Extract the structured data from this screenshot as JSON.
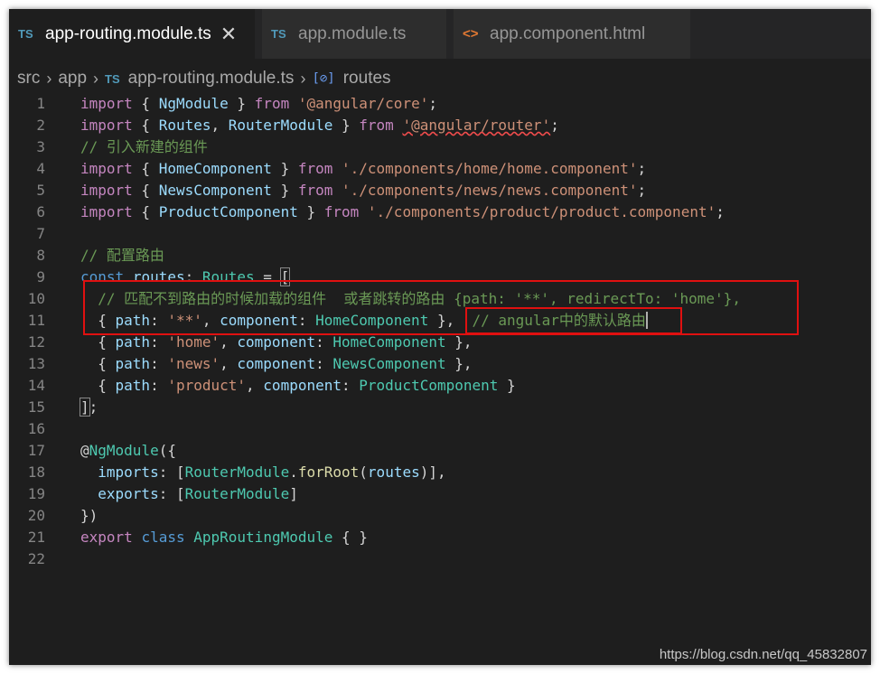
{
  "tabs": [
    {
      "icon": "TS",
      "label": "app-routing.module.ts",
      "active": true,
      "close": "✕"
    },
    {
      "icon": "TS",
      "label": "app.module.ts",
      "active": false
    },
    {
      "icon": "<>",
      "label": "app.component.html",
      "active": false
    }
  ],
  "breadcrumb": {
    "items": [
      "src",
      "app",
      "app-routing.module.ts",
      "routes"
    ],
    "file_icon": "TS",
    "symbol_icon": "[⊘]"
  },
  "lines": [
    {
      "n": "1",
      "tokens": [
        [
          "kw2",
          "import"
        ],
        [
          "p",
          " { "
        ],
        [
          "var",
          "NgModule"
        ],
        [
          "p",
          " } "
        ],
        [
          "kw2",
          "from"
        ],
        [
          "p",
          " "
        ],
        [
          "str",
          "'@angular/core'"
        ],
        [
          "p",
          ";"
        ]
      ]
    },
    {
      "n": "2",
      "tokens": [
        [
          "kw2",
          "import"
        ],
        [
          "p",
          " { "
        ],
        [
          "var",
          "Routes"
        ],
        [
          "p",
          ", "
        ],
        [
          "var",
          "RouterModule"
        ],
        [
          "p",
          " } "
        ],
        [
          "kw2",
          "from"
        ],
        [
          "p",
          " "
        ],
        [
          "strsq",
          "'@angular/router'"
        ],
        [
          "p",
          ";"
        ]
      ]
    },
    {
      "n": "3",
      "tokens": [
        [
          "cm",
          "// 引入新建的组件"
        ]
      ]
    },
    {
      "n": "4",
      "tokens": [
        [
          "kw2",
          "import"
        ],
        [
          "p",
          " { "
        ],
        [
          "var",
          "HomeComponent"
        ],
        [
          "p",
          " } "
        ],
        [
          "kw2",
          "from"
        ],
        [
          "p",
          " "
        ],
        [
          "str",
          "'./components/home/home.component'"
        ],
        [
          "p",
          ";"
        ]
      ]
    },
    {
      "n": "5",
      "tokens": [
        [
          "kw2",
          "import"
        ],
        [
          "p",
          " { "
        ],
        [
          "var",
          "NewsComponent"
        ],
        [
          "p",
          " } "
        ],
        [
          "kw2",
          "from"
        ],
        [
          "p",
          " "
        ],
        [
          "str",
          "'./components/news/news.component'"
        ],
        [
          "p",
          ";"
        ]
      ]
    },
    {
      "n": "6",
      "tokens": [
        [
          "kw2",
          "import"
        ],
        [
          "p",
          " { "
        ],
        [
          "var",
          "ProductComponent"
        ],
        [
          "p",
          " } "
        ],
        [
          "kw2",
          "from"
        ],
        [
          "p",
          " "
        ],
        [
          "str",
          "'./components/product/product.component'"
        ],
        [
          "p",
          ";"
        ]
      ]
    },
    {
      "n": "7",
      "tokens": []
    },
    {
      "n": "8",
      "tokens": [
        [
          "cm",
          "// 配置路由"
        ]
      ]
    },
    {
      "n": "9",
      "tokens": [
        [
          "kw",
          "const"
        ],
        [
          "p",
          " "
        ],
        [
          "var",
          "routes"
        ],
        [
          "p",
          ": "
        ],
        [
          "typ",
          "Routes"
        ],
        [
          "p",
          " = "
        ],
        [
          "brk",
          "["
        ]
      ]
    },
    {
      "n": "10",
      "tokens": [
        [
          "p",
          "  "
        ],
        [
          "cm",
          "// 匹配不到路由的时候加载的组件  或者跳转的路由 {path: '**', redirectTo: 'home'},"
        ]
      ]
    },
    {
      "n": "11",
      "tokens": [
        [
          "p",
          "  { "
        ],
        [
          "var",
          "path"
        ],
        [
          "p",
          ": "
        ],
        [
          "str",
          "'**'"
        ],
        [
          "p",
          ", "
        ],
        [
          "var",
          "component"
        ],
        [
          "p",
          ": "
        ],
        [
          "typ",
          "HomeComponent"
        ],
        [
          "p",
          " },  "
        ],
        [
          "cm",
          "// angular中的默认路由"
        ],
        [
          "cur",
          ""
        ]
      ]
    },
    {
      "n": "12",
      "tokens": [
        [
          "p",
          "  { "
        ],
        [
          "var",
          "path"
        ],
        [
          "p",
          ": "
        ],
        [
          "str",
          "'home'"
        ],
        [
          "p",
          ", "
        ],
        [
          "var",
          "component"
        ],
        [
          "p",
          ": "
        ],
        [
          "typ",
          "HomeComponent"
        ],
        [
          "p",
          " },"
        ]
      ]
    },
    {
      "n": "13",
      "tokens": [
        [
          "p",
          "  { "
        ],
        [
          "var",
          "path"
        ],
        [
          "p",
          ": "
        ],
        [
          "str",
          "'news'"
        ],
        [
          "p",
          ", "
        ],
        [
          "var",
          "component"
        ],
        [
          "p",
          ": "
        ],
        [
          "typ",
          "NewsComponent"
        ],
        [
          "p",
          " },"
        ]
      ]
    },
    {
      "n": "14",
      "tokens": [
        [
          "p",
          "  { "
        ],
        [
          "var",
          "path"
        ],
        [
          "p",
          ": "
        ],
        [
          "str",
          "'product'"
        ],
        [
          "p",
          ", "
        ],
        [
          "var",
          "component"
        ],
        [
          "p",
          ": "
        ],
        [
          "typ",
          "ProductComponent"
        ],
        [
          "p",
          " }"
        ]
      ]
    },
    {
      "n": "15",
      "tokens": [
        [
          "brk",
          "]"
        ],
        [
          "p",
          ";"
        ]
      ]
    },
    {
      "n": "16",
      "tokens": []
    },
    {
      "n": "17",
      "tokens": [
        [
          "p",
          "@"
        ],
        [
          "typ",
          "NgModule"
        ],
        [
          "p",
          "({"
        ]
      ]
    },
    {
      "n": "18",
      "tokens": [
        [
          "p",
          "  "
        ],
        [
          "var",
          "imports"
        ],
        [
          "p",
          ": ["
        ],
        [
          "typ",
          "RouterModule"
        ],
        [
          "p",
          "."
        ],
        [
          "fn",
          "forRoot"
        ],
        [
          "p",
          "("
        ],
        [
          "var",
          "routes"
        ],
        [
          "p",
          ")],"
        ]
      ]
    },
    {
      "n": "19",
      "tokens": [
        [
          "p",
          "  "
        ],
        [
          "var",
          "exports"
        ],
        [
          "p",
          ": ["
        ],
        [
          "typ",
          "RouterModule"
        ],
        [
          "p",
          "]"
        ]
      ]
    },
    {
      "n": "20",
      "tokens": [
        [
          "p",
          "})"
        ]
      ]
    },
    {
      "n": "21",
      "tokens": [
        [
          "kw2",
          "export"
        ],
        [
          "p",
          " "
        ],
        [
          "kw",
          "class"
        ],
        [
          "p",
          " "
        ],
        [
          "typ",
          "AppRoutingModule"
        ],
        [
          "p",
          " { }"
        ]
      ]
    },
    {
      "n": "22",
      "tokens": []
    }
  ],
  "watermark": "https://blog.csdn.net/qq_45832807",
  "colors": {
    "editor_bg": "#1e1e1e",
    "highlight_box": "#e01010",
    "keyword": "#569cd6",
    "control_keyword": "#c586c0",
    "string": "#ce9178",
    "type": "#4ec9b0",
    "variable": "#9cdcfe",
    "comment": "#6a9955"
  }
}
